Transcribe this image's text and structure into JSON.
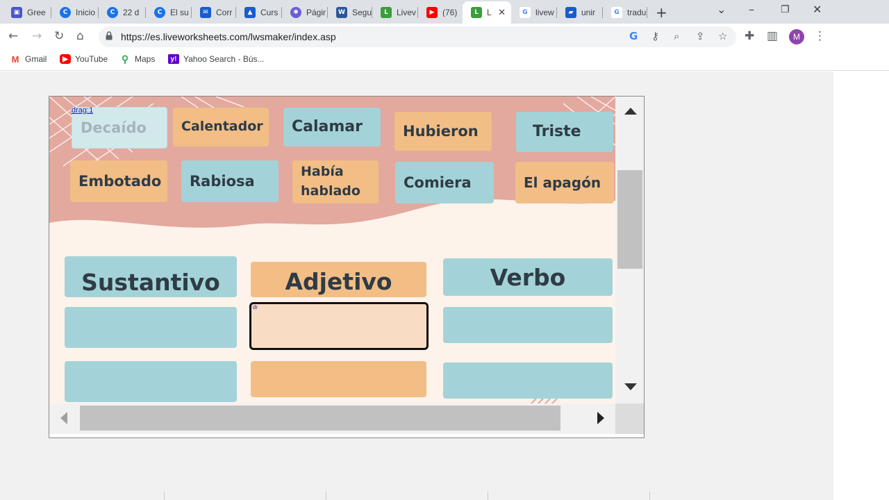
{
  "browser": {
    "tabs": [
      {
        "label": "Gree",
        "icon": "meet-icon",
        "color": "#4b57c8"
      },
      {
        "label": "Inicio",
        "icon": "c-icon",
        "color": "#1a73e8"
      },
      {
        "label": "22 d",
        "icon": "c-icon",
        "color": "#1a73e8"
      },
      {
        "label": "El su",
        "icon": "c-icon",
        "color": "#1a73e8"
      },
      {
        "label": "Corr",
        "icon": "mail-icon",
        "color": "#1a5ccc"
      },
      {
        "label": "Curs",
        "icon": "mortarboard-icon",
        "color": "#1a5ccc"
      },
      {
        "label": "Págir",
        "icon": "pinwheel-icon",
        "color": "#6b5bd6"
      },
      {
        "label": "Segu",
        "icon": "word-icon",
        "color": "#2b579a"
      },
      {
        "label": "Livev",
        "icon": "liveworksheets-icon",
        "color": "#3a9e3a"
      },
      {
        "label": "(76)",
        "icon": "youtube-icon",
        "color": "#ff0000"
      },
      {
        "label": "L",
        "icon": "liveworksheets-icon",
        "color": "#3a9e3a",
        "active": true
      },
      {
        "label": "livew",
        "icon": "google-icon",
        "color": "#4285f4"
      },
      {
        "label": "unir",
        "icon": "clapper-icon",
        "color": "#1a5ccc"
      },
      {
        "label": "tradu",
        "icon": "google-icon",
        "color": "#4285f4"
      }
    ],
    "url": "https://es.liveworksheets.com/lwsmaker/index.asp",
    "profile_initial": "M",
    "bookmarks": [
      {
        "label": "Gmail",
        "icon": "gmail-icon",
        "color": "#ea4335"
      },
      {
        "label": "YouTube",
        "icon": "youtube-icon",
        "color": "#ff0000"
      },
      {
        "label": "Maps",
        "icon": "maps-pin-icon",
        "color": "#34a853"
      },
      {
        "label": "Yahoo Search - Bús...",
        "icon": "yahoo-icon",
        "color": "#5f01d1"
      }
    ]
  },
  "worksheet": {
    "drag_label": "drag:1",
    "drop_label": "dr",
    "words": [
      {
        "text": "Decaído",
        "color": "teal",
        "state": "selected"
      },
      {
        "text": "Calentador",
        "color": "orange"
      },
      {
        "text": "Calamar",
        "color": "teal"
      },
      {
        "text": "Hubieron",
        "color": "orange"
      },
      {
        "text": "Triste",
        "color": "teal"
      },
      {
        "text": "Embotado",
        "color": "orange"
      },
      {
        "text": "Rabiosa",
        "color": "teal"
      },
      {
        "text": "Había hablado",
        "color": "orange"
      },
      {
        "text": "Comiera",
        "color": "teal"
      },
      {
        "text": "El apagón",
        "color": "orange"
      }
    ],
    "categories": [
      "Sustantivo",
      "Adjetivo",
      "Verbo"
    ],
    "colors": {
      "teal": "#a3d3d8",
      "orange": "#f2be86",
      "pink_band": "#e3a89e",
      "background": "#fdf3ea"
    }
  }
}
